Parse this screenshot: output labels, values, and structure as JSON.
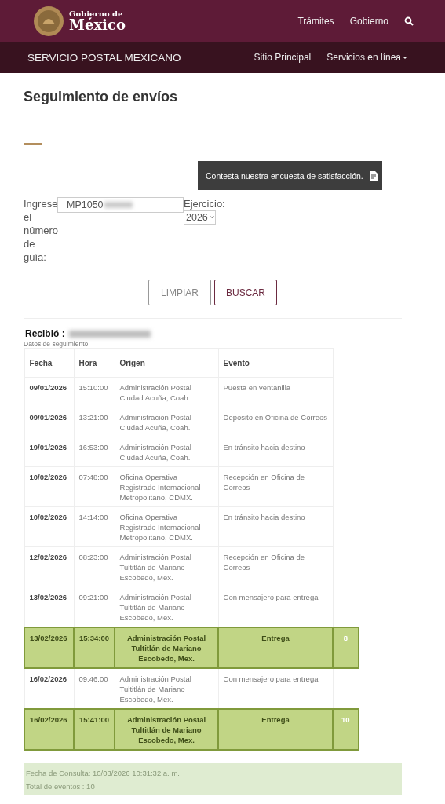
{
  "header": {
    "logo_top": "Gobierno de",
    "logo_bottom": "México",
    "nav": [
      "Trámites",
      "Gobierno"
    ]
  },
  "subheader": {
    "title": "SERVICIO POSTAL MEXICANO",
    "links": [
      {
        "label": "Sitio Principal",
        "dropdown": false
      },
      {
        "label": "Servicios en línea",
        "dropdown": true
      }
    ]
  },
  "page_title": "Seguimiento de envíos",
  "survey": {
    "text": "Contesta nuestra encuesta de satisfacción."
  },
  "form": {
    "label": "Ingrese el número de guía:",
    "value": "MP1050",
    "value_redacted": true,
    "year_label": "Ejercicio:",
    "year": "2026",
    "buttons": [
      {
        "label": "LIMPIAR",
        "kind": "secondary"
      },
      {
        "label": "BUSCAR",
        "kind": "primary"
      }
    ]
  },
  "recipient": {
    "label": "Recibió :",
    "redacted": true
  },
  "table": {
    "caption": "Datos de seguimiento",
    "columns": [
      "Fecha",
      "Hora",
      "Origen",
      "Evento"
    ],
    "rows": [
      {
        "kind": "event",
        "date": "09/01/2026",
        "time": "15:10:00",
        "origin": "Administración Postal Ciudad Acuña, Coah.",
        "event": "Puesta en ventanilla"
      },
      {
        "kind": "event",
        "date": "09/01/2026",
        "time": "13:21:00",
        "origin": "Administración Postal Ciudad Acuña, Coah.",
        "event": "Depósito en Oficina de Correos"
      },
      {
        "kind": "event",
        "date": "19/01/2026",
        "time": "16:53:00",
        "origin": "Administración Postal Ciudad Acuña, Coah.",
        "event": "En tránsito hacia destino"
      },
      {
        "kind": "event",
        "date": "10/02/2026",
        "time": "07:48:00",
        "origin": "Oficina Operativa Registrado Internacional Metropolitano, CDMX.",
        "event": "Recepción en Oficina de Correos"
      },
      {
        "kind": "event",
        "date": "10/02/2026",
        "time": "14:14:00",
        "origin": "Oficina Operativa Registrado Internacional Metropolitano, CDMX.",
        "event": "En tránsito hacia destino"
      },
      {
        "kind": "event",
        "date": "12/02/2026",
        "time": "08:23:00",
        "origin": "Administración Postal Tultitlán de Mariano Escobedo, Mex.",
        "event": "Recepción en Oficina de Correos"
      },
      {
        "kind": "event",
        "date": "13/02/2026",
        "time": "09:21:00",
        "origin": "Administración Postal Tultitlán de Mariano Escobedo, Mex.",
        "event": "Con mensajero para entrega"
      },
      {
        "kind": "delivery",
        "date": "13/02/2026",
        "time": "15:34:00",
        "origin": "Administración Postal Tultitlán de Mariano Escobedo, Mex.",
        "event": "Entrega",
        "count": "8"
      },
      {
        "kind": "event",
        "date": "16/02/2026",
        "time": "09:46:00",
        "origin": "Administración Postal Tultitlán de Mariano Escobedo, Mex.",
        "event": "Con mensajero para entrega"
      },
      {
        "kind": "delivery",
        "date": "16/02/2026",
        "time": "15:41:00",
        "origin": "Administración Postal Tultitlán de Mariano Escobedo, Mex.",
        "event": "Entrega",
        "count": "10"
      }
    ]
  },
  "summary": [
    "Fecha de Consulta: 10/03/2026 10:31:32 a. m.",
    "Total de eventos : 10"
  ]
}
